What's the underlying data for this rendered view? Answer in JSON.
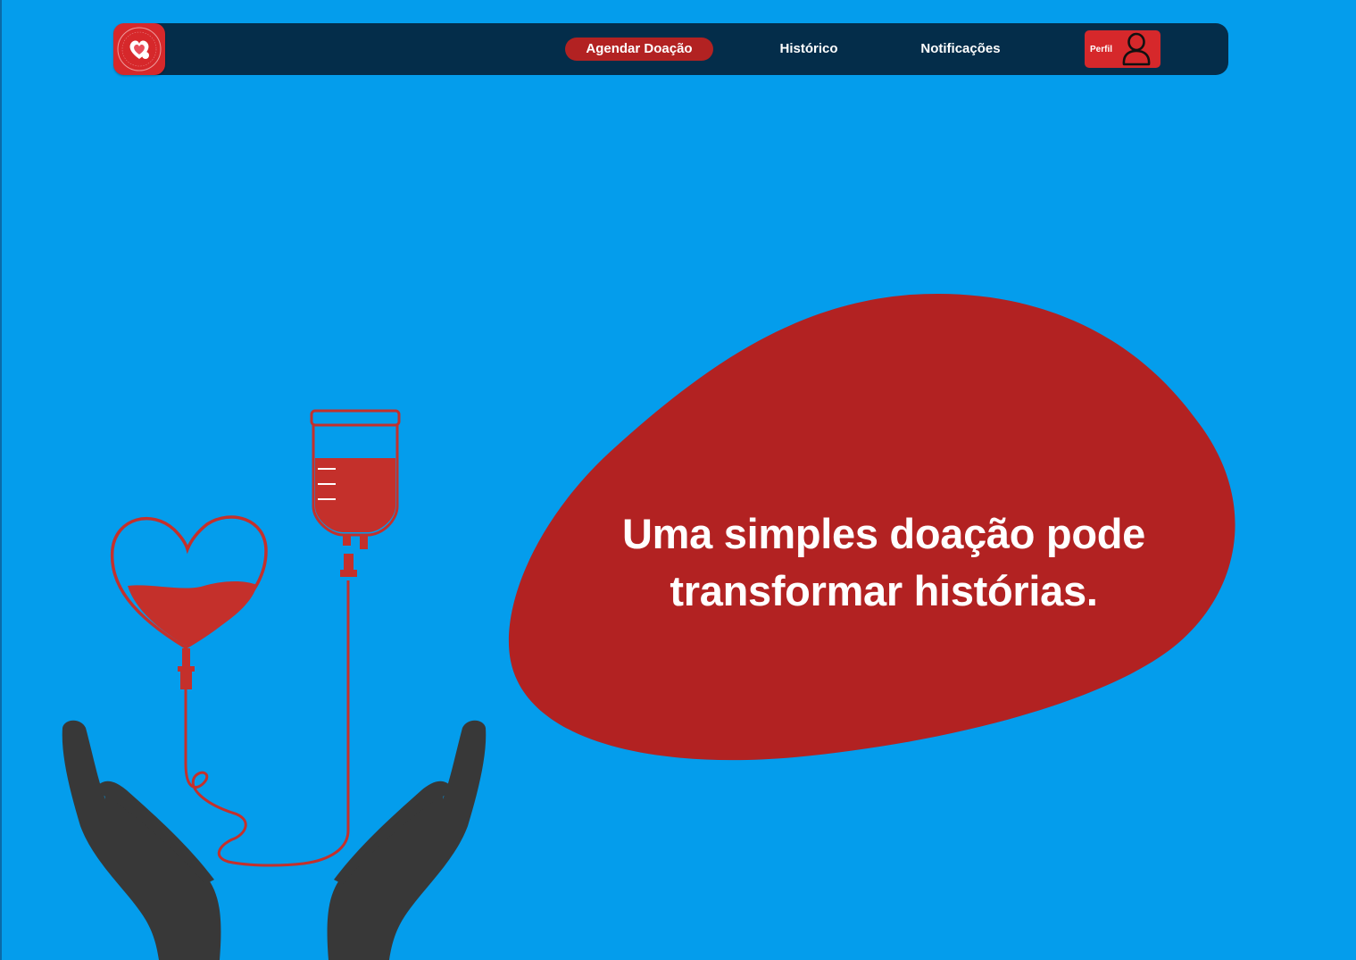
{
  "navbar": {
    "logo_icon": "heart-badge-icon",
    "items": [
      {
        "label": "Agendar Doação",
        "active": true
      },
      {
        "label": "Histórico",
        "active": false
      },
      {
        "label": "Notificações",
        "active": false
      }
    ],
    "profile": {
      "label": "Perfil",
      "icon": "user-icon"
    }
  },
  "hero": {
    "headline_line1": "Uma simples doação pode",
    "headline_line2": "transformar histórias.",
    "illustration_icons": [
      "heart-blood-bag-icon",
      "iv-blood-bag-icon",
      "hands-icon"
    ]
  },
  "colors": {
    "background": "#049dec",
    "navbar": "#042d4a",
    "accent_red": "#b22222",
    "logo_red": "#d6282b",
    "hands": "#383838",
    "text": "#ffffff"
  }
}
